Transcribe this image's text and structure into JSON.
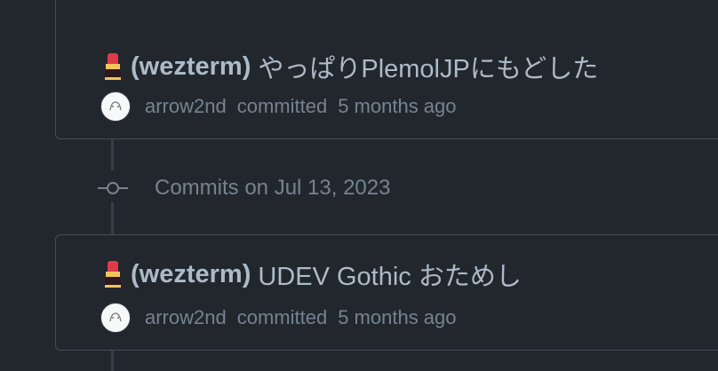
{
  "commits_before_group": [
    {
      "title": "(wezterm)",
      "message_rest": "やっぱりPlemolJPにもどした",
      "author": "arrow2nd",
      "action": "committed",
      "time": "5 months ago"
    }
  ],
  "group": {
    "label": "Commits on Jul 13, 2023"
  },
  "commits_after_group": [
    {
      "title": "(wezterm)",
      "message_rest": "UDEV Gothic おためし",
      "author": "arrow2nd",
      "action": "committed",
      "time": "5 months ago"
    }
  ],
  "icons": {
    "emoji": "lipstick-icon",
    "commit": "git-commit-icon",
    "avatar": "user-avatar"
  }
}
